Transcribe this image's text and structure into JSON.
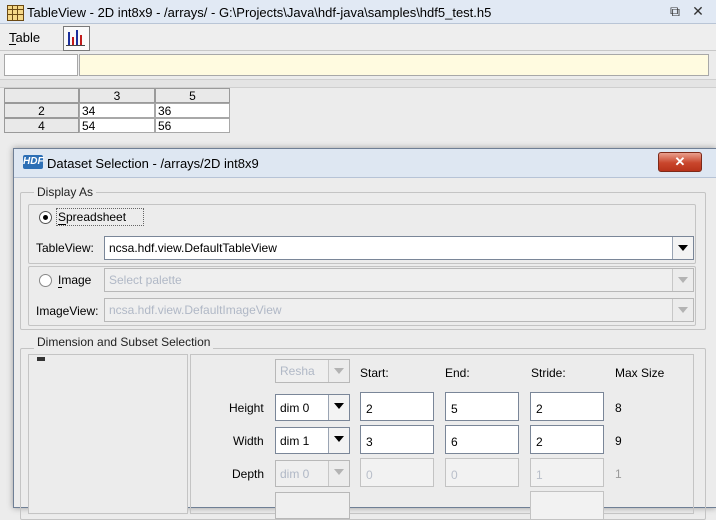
{
  "window": {
    "title": "TableView  -  2D int8x9  -  /arrays/  -  G:\\Projects\\Java\\hdf-java\\samples\\hdf5_test.h5",
    "restore_glyph": "⧉",
    "close_glyph": "✕"
  },
  "menubar": {
    "table_label": "Table"
  },
  "icons": {
    "app": "table-grid-icon",
    "chart": "bar-chart-icon",
    "dialog": "hdf-logo-icon"
  },
  "grid": {
    "col_headers": [
      "3",
      "5"
    ],
    "rows": [
      {
        "header": "2",
        "cells": [
          "34",
          "36"
        ]
      },
      {
        "header": "4",
        "cells": [
          "54",
          "56"
        ]
      }
    ]
  },
  "dialog": {
    "title": "Dataset Selection - /arrays/2D int8x9",
    "close_glyph": "✕",
    "display_as": {
      "label": "Display As",
      "spreadsheet_label": "Spreadsheet",
      "tableview_label": "TableView:",
      "tableview_value": "ncsa.hdf.view.DefaultTableView",
      "image_label": "Image",
      "palette_placeholder": "Select palette",
      "imageview_label": "ImageView:",
      "imageview_value": "ncsa.hdf.view.DefaultImageView"
    },
    "subset": {
      "label": "Dimension and Subset Selection",
      "reshape_value": "Resha",
      "headers": {
        "start": "Start:",
        "end": "End:",
        "stride": "Stride:",
        "max": "Max Size"
      },
      "rows": [
        {
          "label": "Height",
          "dim": "dim 0",
          "start": "2",
          "end": "5",
          "stride": "2",
          "max": "8",
          "enabled": true
        },
        {
          "label": "Width",
          "dim": "dim 1",
          "start": "3",
          "end": "6",
          "stride": "2",
          "max": "9",
          "enabled": true
        },
        {
          "label": "Depth",
          "dim": "dim 0",
          "start": "0",
          "end": "0",
          "stride": "1",
          "max": "1",
          "enabled": false
        }
      ]
    }
  },
  "colors": {
    "title_bg": "#e1e9f4",
    "edit_bg": "#fffbe0",
    "close_red": "#c9462c"
  }
}
